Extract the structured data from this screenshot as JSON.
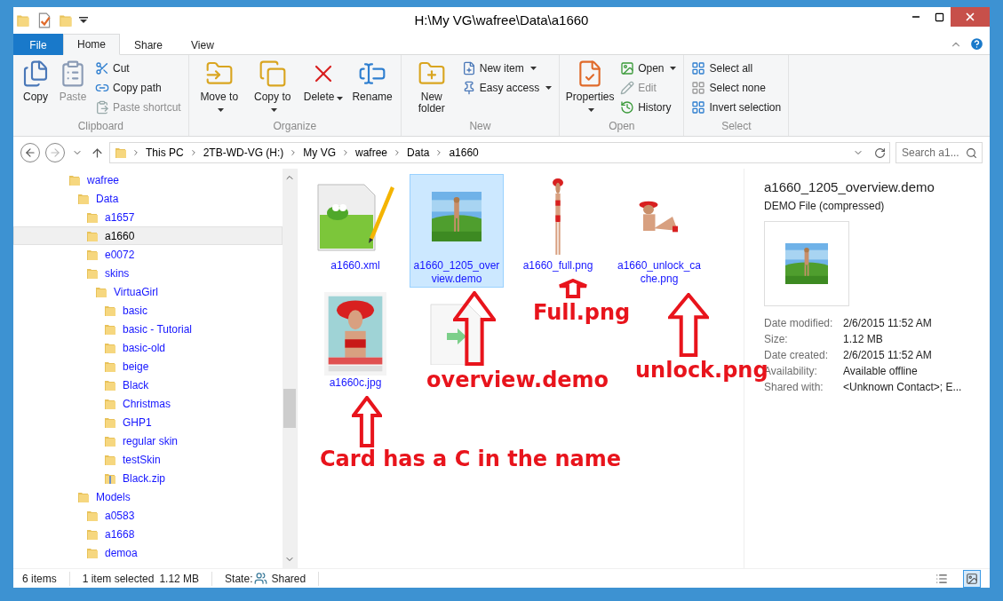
{
  "window": {
    "title": "H:\\My VG\\wafree\\Data\\a1660"
  },
  "ribbon": {
    "tabs": [
      {
        "label": "File",
        "kind": "file",
        "selected": false
      },
      {
        "label": "Home",
        "kind": "tab",
        "selected": true
      },
      {
        "label": "Share",
        "kind": "tab",
        "selected": false
      },
      {
        "label": "View",
        "kind": "tab",
        "selected": false
      }
    ],
    "groups": [
      {
        "label": "Clipboard",
        "buttons": [
          {
            "label": "Copy",
            "kind": "large",
            "disabled": false,
            "dropdown": false
          },
          {
            "label": "Paste",
            "kind": "large",
            "disabled": true,
            "dropdown": false
          },
          {
            "label": "Cut",
            "kind": "small",
            "disabled": false,
            "dropdown": false
          },
          {
            "label": "Copy path",
            "kind": "small",
            "disabled": false,
            "dropdown": false
          },
          {
            "label": "Paste shortcut",
            "kind": "small",
            "disabled": true,
            "dropdown": false
          }
        ]
      },
      {
        "label": "Organize",
        "buttons": [
          {
            "label": "Move to",
            "kind": "large",
            "disabled": false,
            "dropdown": true
          },
          {
            "label": "Copy to",
            "kind": "large",
            "disabled": false,
            "dropdown": true
          },
          {
            "label": "Delete",
            "kind": "large",
            "disabled": false,
            "dropdown": true
          },
          {
            "label": "Rename",
            "kind": "large",
            "disabled": false,
            "dropdown": false
          }
        ]
      },
      {
        "label": "New",
        "buttons": [
          {
            "label": "New folder",
            "kind": "large",
            "disabled": false,
            "dropdown": false
          },
          {
            "label": "New item",
            "kind": "small",
            "disabled": false,
            "dropdown": true
          },
          {
            "label": "Easy access",
            "kind": "small",
            "disabled": false,
            "dropdown": true
          }
        ]
      },
      {
        "label": "Open",
        "buttons": [
          {
            "label": "Properties",
            "kind": "large",
            "disabled": false,
            "dropdown": true
          },
          {
            "label": "Open",
            "kind": "small",
            "disabled": false,
            "dropdown": true
          },
          {
            "label": "Edit",
            "kind": "small",
            "disabled": true,
            "dropdown": false
          },
          {
            "label": "History",
            "kind": "small",
            "disabled": false,
            "dropdown": false
          }
        ]
      },
      {
        "label": "Select",
        "buttons": [
          {
            "label": "Select all",
            "kind": "small",
            "disabled": false,
            "dropdown": false
          },
          {
            "label": "Select none",
            "kind": "small",
            "disabled": false,
            "dropdown": false
          },
          {
            "label": "Invert selection",
            "kind": "small",
            "disabled": false,
            "dropdown": false
          }
        ]
      }
    ]
  },
  "address": {
    "segments": [
      "This PC",
      "2TB-WD-VG (H:)",
      "My VG",
      "wafree",
      "Data",
      "a1660"
    ]
  },
  "search": {
    "placeholder": "Search a1..."
  },
  "nav_tree": [
    {
      "label": "wafree",
      "kind": "folder",
      "selected": false,
      "children": [
        {
          "label": "Data",
          "kind": "folder",
          "selected": false,
          "children": [
            {
              "label": "a1657",
              "kind": "folder",
              "selected": false
            },
            {
              "label": "a1660",
              "kind": "folder",
              "selected": true
            },
            {
              "label": "e0072",
              "kind": "folder",
              "selected": false
            },
            {
              "label": "skins",
              "kind": "folder",
              "selected": false,
              "children": [
                {
                  "label": "VirtuaGirl",
                  "kind": "folder",
                  "selected": false,
                  "children": [
                    {
                      "label": "basic",
                      "kind": "folder",
                      "selected": false
                    },
                    {
                      "label": "basic - Tutorial",
                      "kind": "folder",
                      "selected": false
                    },
                    {
                      "label": "basic-old",
                      "kind": "folder",
                      "selected": false
                    },
                    {
                      "label": "beige",
                      "kind": "folder",
                      "selected": false
                    },
                    {
                      "label": "Black",
                      "kind": "folder",
                      "selected": false
                    },
                    {
                      "label": "Christmas",
                      "kind": "folder",
                      "selected": false
                    },
                    {
                      "label": "GHP1",
                      "kind": "folder",
                      "selected": false
                    },
                    {
                      "label": "regular skin",
                      "kind": "folder",
                      "selected": false
                    },
                    {
                      "label": "testSkin",
                      "kind": "folder",
                      "selected": false
                    },
                    {
                      "label": "Black.zip",
                      "kind": "zip",
                      "selected": false
                    }
                  ]
                }
              ]
            }
          ]
        },
        {
          "label": "Models",
          "kind": "folder",
          "selected": false,
          "children": [
            {
              "label": "a0583",
              "kind": "folder",
              "selected": false
            },
            {
              "label": "a1668",
              "kind": "folder",
              "selected": false
            },
            {
              "label": "demoa",
              "kind": "folder",
              "selected": false
            }
          ]
        }
      ]
    }
  ],
  "files": [
    {
      "name": "a1660.xml",
      "kind": "notepad",
      "selected": false
    },
    {
      "name": "a1660_1205_overview.demo",
      "kind": "picture",
      "selected": true
    },
    {
      "name": "a1660_full.png",
      "kind": "picture",
      "selected": false
    },
    {
      "name": "a1660_unlock_cache.png",
      "kind": "picture",
      "selected": false
    },
    {
      "name": "a1660c.jpg",
      "kind": "picture",
      "selected": false
    },
    {
      "kind": "generic",
      "selected": false
    }
  ],
  "details": {
    "title": "a1660_1205_overview.demo",
    "type": "DEMO File (compressed)",
    "properties": [
      {
        "label": "Date modified:",
        "value": "2/6/2015 11:52 AM"
      },
      {
        "label": "Size:",
        "value": "1.12 MB"
      },
      {
        "label": "Date created:",
        "value": "2/6/2015 11:52 AM"
      },
      {
        "label": "Availability:",
        "value": "Available offline"
      },
      {
        "label": "Shared with:",
        "value": "<Unknown Contact>; E..."
      }
    ]
  },
  "status_bar": {
    "count": "6 items",
    "selection": "1 item selected",
    "size": "1.12 MB",
    "state_label": "State:",
    "state": "Shared",
    "views": [
      {
        "selected": false
      },
      {
        "selected": true
      }
    ]
  },
  "annotations": [
    {
      "text": "Full.png"
    },
    {
      "text": "overview.demo"
    },
    {
      "text": "unlock.png"
    },
    {
      "text": "Card has a C in the name"
    }
  ]
}
